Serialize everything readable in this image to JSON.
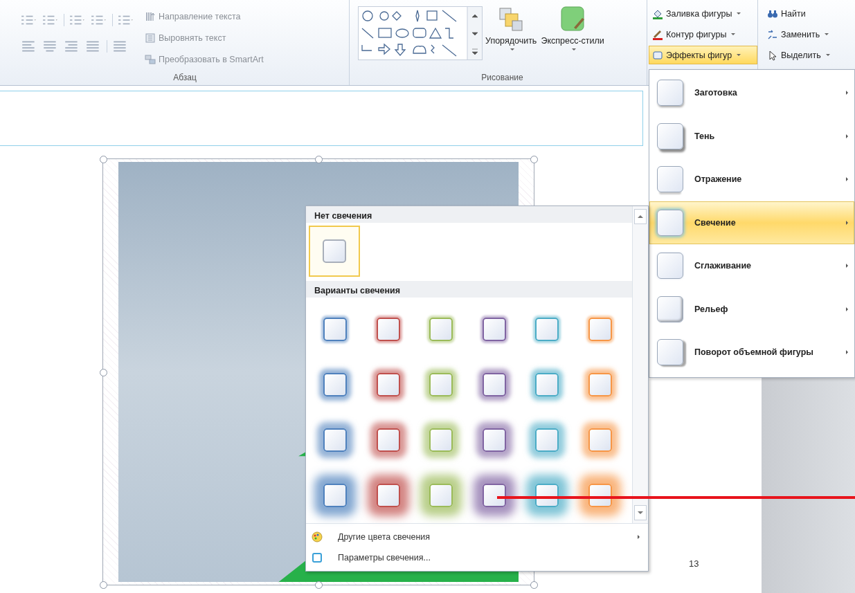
{
  "ribbon": {
    "paragraph_group": {
      "label": "Абзац",
      "commands": [
        {
          "kind": "text-direction",
          "label": "Направление текста"
        },
        {
          "kind": "align-text",
          "label": "Выровнять текст"
        },
        {
          "kind": "smartart",
          "label": "Преобразовать в SmartArt"
        }
      ]
    },
    "drawing_group": {
      "label": "Рисование",
      "arrange": "Упорядочить",
      "quick_styles": "Экспресс-стили"
    },
    "shape_commands": [
      {
        "kind": "fill",
        "label": "Заливка фигуры",
        "selected": false
      },
      {
        "kind": "outline",
        "label": "Контур фигуры",
        "selected": false
      },
      {
        "kind": "effects",
        "label": "Эффекты фигур",
        "selected": true
      }
    ],
    "editing_commands": [
      {
        "kind": "find",
        "label": "Найти"
      },
      {
        "kind": "replace",
        "label": "Заменить"
      },
      {
        "kind": "select",
        "label": "Выделить"
      }
    ]
  },
  "document": {
    "page_number": "13"
  },
  "effects_menu": {
    "items": [
      {
        "kind": "preset",
        "label": "Заготовка",
        "selected": false
      },
      {
        "kind": "shadow",
        "label": "Тень",
        "selected": false
      },
      {
        "kind": "reflection",
        "label": "Отражение",
        "selected": false
      },
      {
        "kind": "glow",
        "label": "Свечение",
        "selected": true
      },
      {
        "kind": "soft",
        "label": "Сглаживание",
        "selected": false
      },
      {
        "kind": "bevel",
        "label": "Рельеф",
        "selected": false
      },
      {
        "kind": "rotation",
        "label": "Поворот объемной фигуры",
        "selected": false
      }
    ]
  },
  "glow_gallery": {
    "no_glow_title": "Нет свечения",
    "no_glow_selected": true,
    "variants_title": "Варианты свечения",
    "colors": [
      {
        "color": "#4f81bd"
      },
      {
        "color": "#c0504d"
      },
      {
        "color": "#9bbb59"
      },
      {
        "color": "#8064a2"
      },
      {
        "color": "#4bacc6"
      },
      {
        "color": "#f79646"
      }
    ],
    "rows": [
      {
        "kind": "small"
      },
      {
        "kind": "medium"
      },
      {
        "kind": "large"
      },
      {
        "kind": "extra-large"
      }
    ],
    "footer": [
      {
        "kind": "colors",
        "label": "Другие цвета свечения"
      },
      {
        "kind": "options",
        "label": "Параметры свечения..."
      }
    ]
  }
}
